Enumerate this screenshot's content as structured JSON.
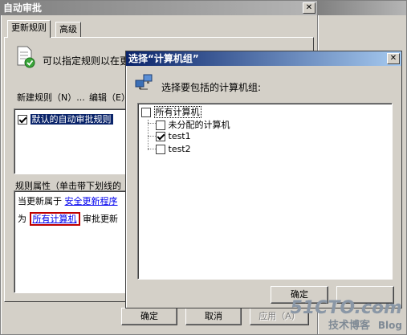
{
  "main_window": {
    "title": "自动审批",
    "tabs": [
      "更新规则",
      "高级"
    ],
    "info_text": "可以指定规则以在更",
    "toolbar": {
      "new_rule": "新建规则（N）...",
      "edit": "编辑（E）"
    },
    "rules": [
      {
        "label": "默认的自动审批规则",
        "checked": true
      }
    ],
    "props_title": "规则属性（单击带下划线的",
    "props_line1_prefix": "当更新属于",
    "props_line1_link": "安全更新程序",
    "props_line2_prefix": "为",
    "props_line2_link": "所有计算机",
    "props_line2_suffix": "审批更新",
    "buttons": {
      "ok": "确定",
      "cancel": "取消",
      "apply": "应用（A）"
    }
  },
  "dialog": {
    "title": "选择“计算机组”",
    "prompt": "选择要包括的计算机组:",
    "tree": {
      "root": {
        "label": "所有计算机",
        "checked": false
      },
      "children": [
        {
          "label": "未分配的计算机",
          "checked": false
        },
        {
          "label": "test1",
          "checked": true
        },
        {
          "label": "test2",
          "checked": false
        }
      ]
    },
    "buttons": {
      "ok": "确定"
    }
  },
  "watermark": {
    "site": "51CTO.com",
    "sub": "技术博客",
    "blog": "Blog"
  }
}
